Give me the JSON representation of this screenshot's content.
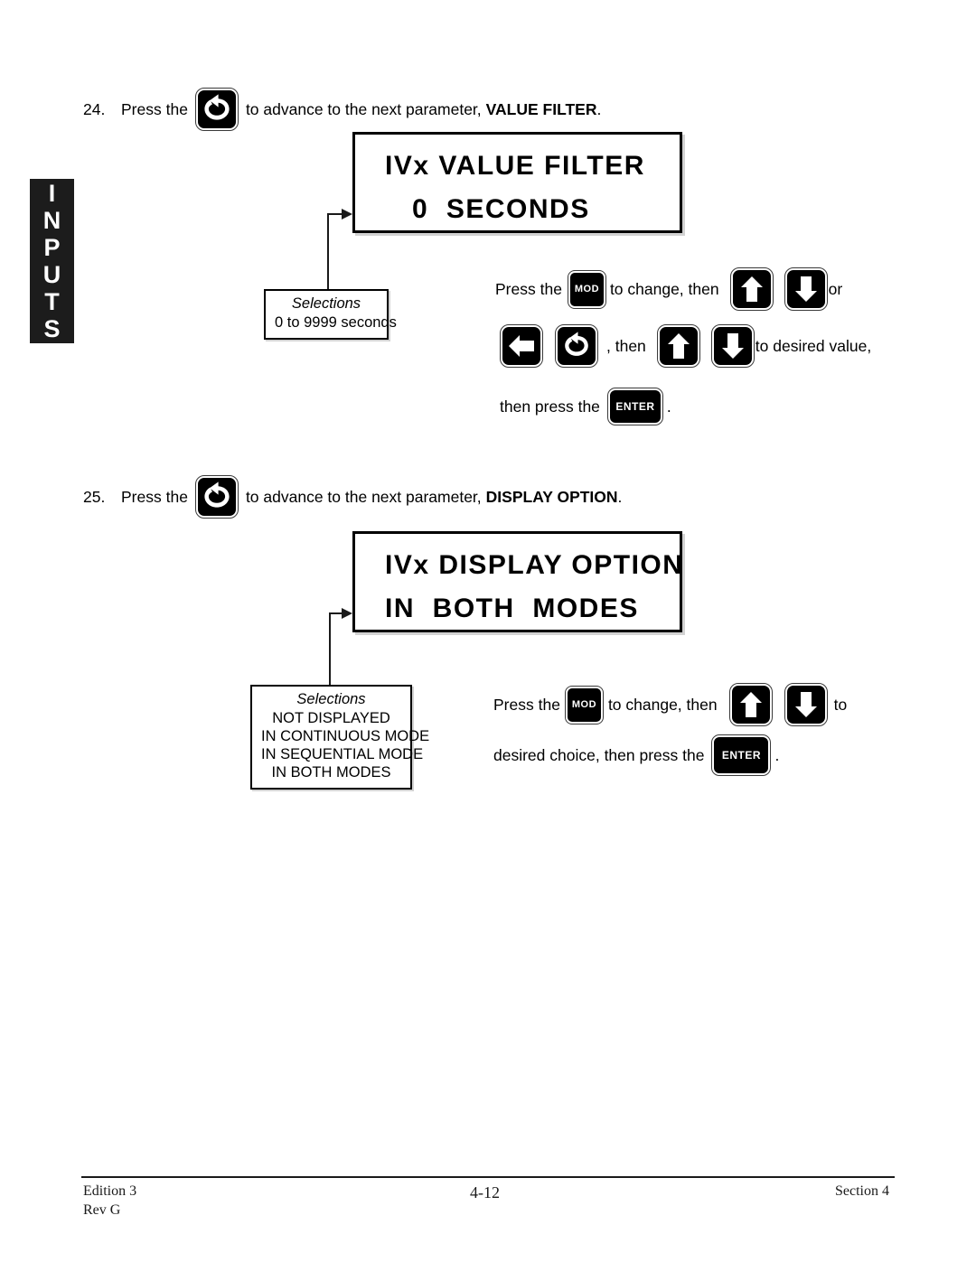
{
  "side_tab": {
    "label": "INPUTS",
    "letters": [
      "I",
      "N",
      "P",
      "U",
      "T",
      "S"
    ]
  },
  "steps": [
    {
      "number": "24.",
      "text_before": "Press  the",
      "icon": "advance-loop-icon",
      "text_after": "to advance to the next parameter,",
      "parameter": "VALUE FILTER",
      "period": "."
    },
    {
      "number": "25.",
      "text_before": "Press the",
      "icon": "advance-loop-icon",
      "text_after": "to advance to the next parameter,",
      "parameter": "DISPLAY OPTION",
      "period": "."
    }
  ],
  "displays": [
    {
      "line1": "IVx VALUE FILTER",
      "line2": "0  SECONDS"
    },
    {
      "line1": "IVx DISPLAY OPTION",
      "line2": "IN  BOTH  MODES"
    }
  ],
  "callouts": [
    {
      "title": "Selections",
      "options": [
        "0 to 9999 seconds"
      ]
    },
    {
      "title": "Selections",
      "options": [
        "NOT DISPLAYED",
        "IN CONTINUOUS MODE",
        "IN SEQUENTIAL MODE",
        "IN BOTH MODES"
      ]
    }
  ],
  "instructions": {
    "block1": {
      "line1_a": "Press  the",
      "mod_label": "MOD",
      "line1_b": "to change, then",
      "line1_c": "or",
      "line2_a": ", then",
      "line2_b": "to desired value,",
      "line3_a": "then press the",
      "enter_label": "ENTER",
      "line3_b": "."
    },
    "block2": {
      "line1_a": "Press  the",
      "mod_label": "MOD",
      "line1_b": "to change,  then",
      "line1_c": "to",
      "line2_a": "desired choice, then press the",
      "enter_label": "ENTER",
      "line2_b": "."
    }
  },
  "footer": {
    "edition": "Edition 3",
    "revision": "Rev G",
    "page": "4-12",
    "section": "Section 4"
  }
}
